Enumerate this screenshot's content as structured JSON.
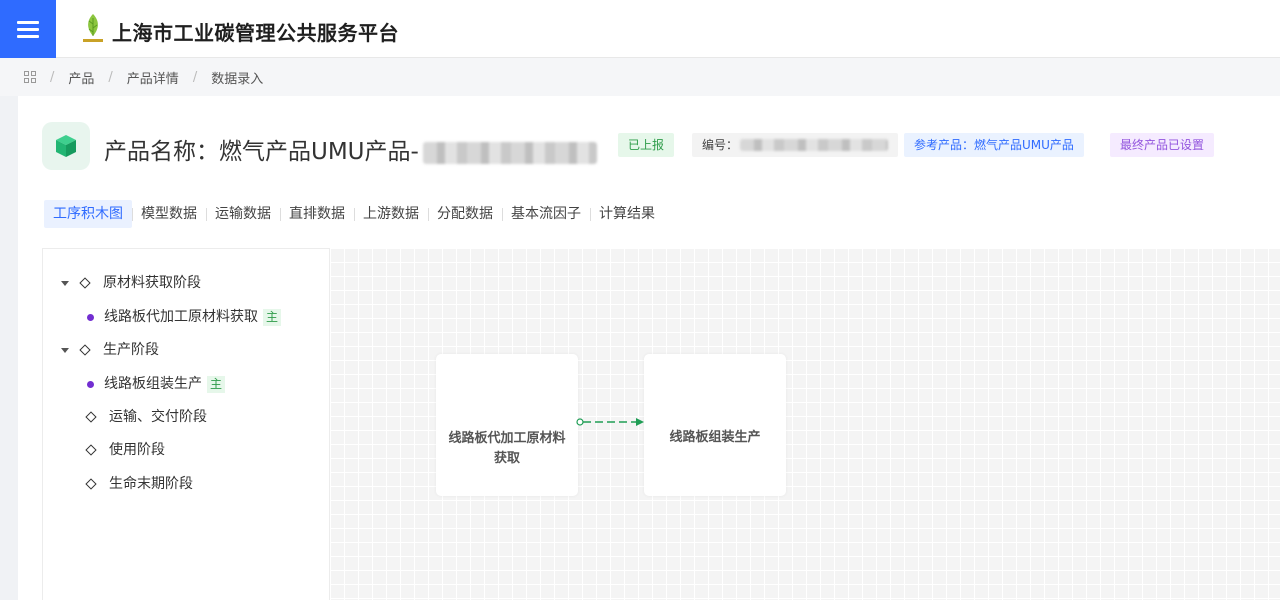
{
  "header": {
    "title": "上海市工业碳管理公共服务平台"
  },
  "breadcrumb": [
    "产品",
    "产品详情",
    "数据录入"
  ],
  "product": {
    "title_prefix": "产品名称：燃气产品UMU产品-",
    "status_tag": "已上报",
    "code_label": "编号：",
    "reference_tag": "参考产品：燃气产品UMU产品",
    "final_tag": "最终产品已设置"
  },
  "tabs": [
    {
      "label": "工序积木图",
      "active": true
    },
    {
      "label": "模型数据"
    },
    {
      "label": "运输数据"
    },
    {
      "label": "直排数据"
    },
    {
      "label": "上游数据"
    },
    {
      "label": "分配数据"
    },
    {
      "label": "基本流因子"
    },
    {
      "label": "计算结果"
    }
  ],
  "tree": {
    "items": [
      {
        "label": "原材料获取阶段",
        "type": "stage",
        "expanded": true
      },
      {
        "label": "线路板代加工原材料获取",
        "type": "process",
        "badge": "主"
      },
      {
        "label": "生产阶段",
        "type": "stage",
        "expanded": true
      },
      {
        "label": "线路板组装生产",
        "type": "process",
        "badge": "主"
      },
      {
        "label": "运输、交付阶段",
        "type": "stage"
      },
      {
        "label": "使用阶段",
        "type": "stage"
      },
      {
        "label": "生命末期阶段",
        "type": "stage"
      }
    ]
  },
  "canvas": {
    "nodes": [
      {
        "label": "线路板代加工原材料获取"
      },
      {
        "label": "线路板组装生产"
      }
    ]
  },
  "colors": {
    "accent": "#2f6bff",
    "process_dot": "#722ed1",
    "edge": "#1f9d55"
  }
}
